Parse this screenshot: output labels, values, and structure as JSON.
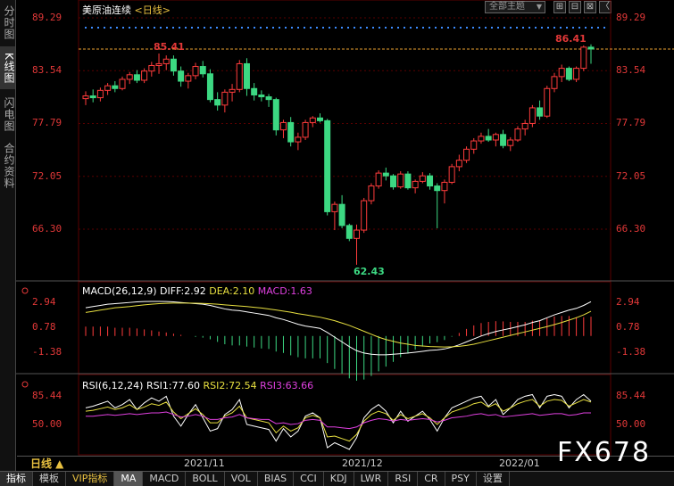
{
  "left_tabs": [
    {
      "label": "分时图",
      "active": false
    },
    {
      "label": "K线图",
      "active": true
    },
    {
      "label": "闪电图",
      "active": false
    },
    {
      "label": "合约资料",
      "active": false
    }
  ],
  "header": {
    "instrument": "美原油连续",
    "period": "<日线>",
    "theme_button": "全部主题",
    "window_buttons": [
      "⊞",
      "⊟",
      "⊠",
      "〈"
    ]
  },
  "price_axis": {
    "ticks": [
      "89.29",
      "83.54",
      "77.79",
      "72.05",
      "66.30"
    ]
  },
  "annotations": {
    "left_high": "85.41",
    "right_high": "86.41",
    "low": "62.43"
  },
  "macd": {
    "label": "MACD(26,12,9)",
    "diff": "DIFF:2.92",
    "dea": "DEA:2.10",
    "macd": "MACD:1.63",
    "ticks": [
      "2.94",
      "0.78",
      "-1.38"
    ]
  },
  "rsi": {
    "label": "RSI(6,12,24)",
    "rsi1": "RSI1:77.60",
    "rsi2": "RSI2:72.54",
    "rsi3": "RSI3:63.66",
    "ticks": [
      "85.44",
      "50.00"
    ]
  },
  "dates": [
    "2021/11",
    "2021/12",
    "2022/01"
  ],
  "period_label": "日线 ▲",
  "toolbar": [
    "指标",
    "模板",
    "VIP指标",
    "MA",
    "MACD",
    "BOLL",
    "VOL",
    "BIAS",
    "CCI",
    "KDJ",
    "LWR",
    "RSI",
    "CR",
    "PSY",
    "设置"
  ],
  "watermark": "FX678",
  "colors": {
    "up": "#ff3c3c",
    "down": "#3cd882",
    "diff": "#ffffff",
    "dea": "#e8e040",
    "rsi3": "#e040e0",
    "grid": "#5a0000",
    "dotted_marks": "#3c8cff"
  },
  "chart_data": {
    "type": "candlestick",
    "candles": [
      [
        80.5,
        81.3,
        79.8,
        80.8
      ],
      [
        80.8,
        81.5,
        80.1,
        80.6
      ],
      [
        80.6,
        81.7,
        80.2,
        81.4
      ],
      [
        81.4,
        82.2,
        80.9,
        81.9
      ],
      [
        81.9,
        82.4,
        81.2,
        81.6
      ],
      [
        81.6,
        82.9,
        81.4,
        82.6
      ],
      [
        82.6,
        83.4,
        82.1,
        83.1
      ],
      [
        83.1,
        83.6,
        82.2,
        82.5
      ],
      [
        82.5,
        83.8,
        82.2,
        83.5
      ],
      [
        83.5,
        84.5,
        82.9,
        84.1
      ],
      [
        84.1,
        85.41,
        83.2,
        84.3
      ],
      [
        84.3,
        85.2,
        83.6,
        84.8
      ],
      [
        84.8,
        85.2,
        83.0,
        83.5
      ],
      [
        83.5,
        84.0,
        81.8,
        82.4
      ],
      [
        82.4,
        83.3,
        81.6,
        83.0
      ],
      [
        83.0,
        84.4,
        82.6,
        84.0
      ],
      [
        84.0,
        84.6,
        82.8,
        83.2
      ],
      [
        83.2,
        83.7,
        80.1,
        80.4
      ],
      [
        80.4,
        81.2,
        79.2,
        79.8
      ],
      [
        79.8,
        81.5,
        79.0,
        81.2
      ],
      [
        81.2,
        82.1,
        80.2,
        81.5
      ],
      [
        81.5,
        84.7,
        81.2,
        84.3
      ],
      [
        84.3,
        84.9,
        80.8,
        81.6
      ],
      [
        81.6,
        82.2,
        80.3,
        80.9
      ],
      [
        80.9,
        81.4,
        80.2,
        80.7
      ],
      [
        80.7,
        81.0,
        79.6,
        80.4
      ],
      [
        80.4,
        80.6,
        76.5,
        77.1
      ],
      [
        77.1,
        78.2,
        76.2,
        77.9
      ],
      [
        77.9,
        78.5,
        75.3,
        75.8
      ],
      [
        75.8,
        76.8,
        74.9,
        76.3
      ],
      [
        76.3,
        78.2,
        76.0,
        77.9
      ],
      [
        77.9,
        78.6,
        77.4,
        78.4
      ],
      [
        78.4,
        78.9,
        77.9,
        78.1
      ],
      [
        78.1,
        78.3,
        67.8,
        68.2
      ],
      [
        68.2,
        69.3,
        66.2,
        69.0
      ],
      [
        69.0,
        70.0,
        66.4,
        66.7
      ],
      [
        66.7,
        66.9,
        65.0,
        65.3
      ],
      [
        65.3,
        66.8,
        62.43,
        66.2
      ],
      [
        66.2,
        69.7,
        65.9,
        69.4
      ],
      [
        69.4,
        71.3,
        69.0,
        71.0
      ],
      [
        71.0,
        72.7,
        70.7,
        72.4
      ],
      [
        72.4,
        73.0,
        71.6,
        72.1
      ],
      [
        72.1,
        72.3,
        70.6,
        70.9
      ],
      [
        70.9,
        72.6,
        70.7,
        72.3
      ],
      [
        72.3,
        72.6,
        70.6,
        70.8
      ],
      [
        70.8,
        71.7,
        70.2,
        71.5
      ],
      [
        71.5,
        72.5,
        71.3,
        72.1
      ],
      [
        72.1,
        72.4,
        70.6,
        71.0
      ],
      [
        71.0,
        71.3,
        66.4,
        70.5
      ],
      [
        70.5,
        71.7,
        69.1,
        71.4
      ],
      [
        71.4,
        73.4,
        71.2,
        73.1
      ],
      [
        73.1,
        74.4,
        72.6,
        73.8
      ],
      [
        73.8,
        75.3,
        73.5,
        75.0
      ],
      [
        75.0,
        76.2,
        74.5,
        75.9
      ],
      [
        75.9,
        76.8,
        75.6,
        76.4
      ],
      [
        76.4,
        77.2,
        75.8,
        76.0
      ],
      [
        76.0,
        76.8,
        75.3,
        76.6
      ],
      [
        76.6,
        77.1,
        75.1,
        75.4
      ],
      [
        75.4,
        76.3,
        74.8,
        76.0
      ],
      [
        76.0,
        77.5,
        75.8,
        77.2
      ],
      [
        77.2,
        78.2,
        76.5,
        77.8
      ],
      [
        77.8,
        79.8,
        77.4,
        79.5
      ],
      [
        79.5,
        80.3,
        78.2,
        78.6
      ],
      [
        78.6,
        81.9,
        78.4,
        81.6
      ],
      [
        81.6,
        83.3,
        81.2,
        82.9
      ],
      [
        82.9,
        84.2,
        82.3,
        83.8
      ],
      [
        83.8,
        84.0,
        82.4,
        82.6
      ],
      [
        82.6,
        84.0,
        82.3,
        83.8
      ],
      [
        83.8,
        86.3,
        83.5,
        86.1
      ],
      [
        86.1,
        86.41,
        84.3,
        85.9
      ]
    ],
    "macd": {
      "diff": [
        2.4,
        2.5,
        2.6,
        2.7,
        2.75,
        2.8,
        2.85,
        2.9,
        2.93,
        2.94,
        2.94,
        2.93,
        2.9,
        2.85,
        2.8,
        2.75,
        2.7,
        2.6,
        2.45,
        2.3,
        2.2,
        2.15,
        2.05,
        1.95,
        1.85,
        1.75,
        1.55,
        1.4,
        1.2,
        1.0,
        0.85,
        0.75,
        0.65,
        0.3,
        -0.1,
        -0.5,
        -0.9,
        -1.25,
        -1.45,
        -1.55,
        -1.6,
        -1.6,
        -1.55,
        -1.5,
        -1.45,
        -1.38,
        -1.3,
        -1.22,
        -1.18,
        -1.1,
        -0.95,
        -0.75,
        -0.5,
        -0.25,
        0.0,
        0.2,
        0.38,
        0.52,
        0.65,
        0.8,
        0.95,
        1.15,
        1.3,
        1.55,
        1.8,
        2.0,
        2.2,
        2.35,
        2.6,
        2.92
      ],
      "dea": [
        2.0,
        2.1,
        2.2,
        2.3,
        2.4,
        2.45,
        2.5,
        2.58,
        2.65,
        2.7,
        2.75,
        2.78,
        2.8,
        2.8,
        2.8,
        2.79,
        2.77,
        2.74,
        2.7,
        2.65,
        2.6,
        2.55,
        2.5,
        2.44,
        2.38,
        2.3,
        2.21,
        2.12,
        2.02,
        1.9,
        1.8,
        1.7,
        1.6,
        1.45,
        1.3,
        1.1,
        0.9,
        0.65,
        0.4,
        0.15,
        -0.1,
        -0.3,
        -0.45,
        -0.6,
        -0.7,
        -0.8,
        -0.85,
        -0.9,
        -0.92,
        -0.93,
        -0.92,
        -0.88,
        -0.8,
        -0.7,
        -0.55,
        -0.4,
        -0.25,
        -0.1,
        0.05,
        0.2,
        0.35,
        0.5,
        0.65,
        0.8,
        0.97,
        1.15,
        1.35,
        1.55,
        1.8,
        2.1
      ],
      "ylim": [
        -2.2,
        3.4
      ]
    },
    "rsi": {
      "rsi1": [
        70,
        72,
        75,
        78,
        70,
        74,
        80,
        68,
        76,
        82,
        78,
        84,
        60,
        48,
        62,
        74,
        58,
        42,
        45,
        62,
        68,
        80,
        50,
        48,
        46,
        44,
        30,
        45,
        35,
        42,
        60,
        64,
        58,
        22,
        28,
        24,
        20,
        34,
        58,
        68,
        74,
        66,
        52,
        66,
        54,
        60,
        66,
        56,
        42,
        58,
        70,
        74,
        78,
        82,
        84,
        72,
        80,
        62,
        70,
        80,
        84,
        86,
        70,
        84,
        86,
        84,
        70,
        80,
        86,
        78
      ],
      "rsi2": [
        66,
        67,
        69,
        71,
        68,
        70,
        74,
        68,
        71,
        75,
        73,
        77,
        65,
        57,
        63,
        69,
        62,
        52,
        52,
        60,
        64,
        72,
        58,
        56,
        54,
        52,
        40,
        48,
        42,
        46,
        58,
        61,
        58,
        35,
        36,
        33,
        30,
        38,
        54,
        62,
        66,
        63,
        55,
        62,
        57,
        60,
        63,
        58,
        50,
        58,
        65,
        68,
        71,
        75,
        77,
        71,
        75,
        66,
        70,
        75,
        78,
        80,
        72,
        78,
        80,
        79,
        72,
        76,
        80,
        77
      ],
      "rsi3": [
        60,
        60,
        61,
        62,
        61,
        62,
        63,
        62,
        63,
        64,
        64,
        65,
        62,
        59,
        60,
        62,
        60,
        56,
        56,
        58,
        59,
        62,
        58,
        57,
        56,
        56,
        51,
        52,
        50,
        51,
        55,
        56,
        55,
        47,
        47,
        46,
        45,
        47,
        52,
        55,
        57,
        56,
        54,
        56,
        55,
        56,
        57,
        56,
        53,
        55,
        58,
        59,
        60,
        62,
        63,
        61,
        62,
        59,
        60,
        61,
        62,
        63,
        61,
        62,
        63,
        63,
        61,
        62,
        64,
        64
      ],
      "ylim": [
        15,
        95
      ]
    }
  }
}
